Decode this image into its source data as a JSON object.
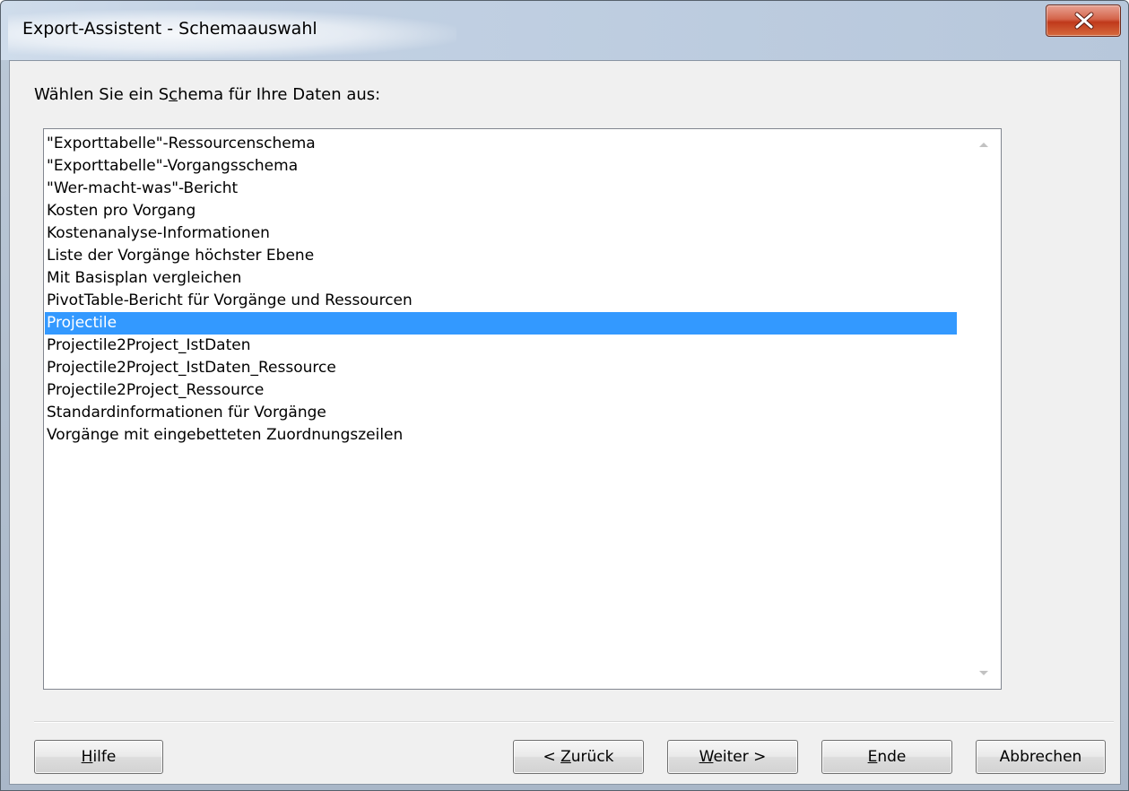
{
  "window": {
    "title": "Export-Assistent - Schemaauswahl"
  },
  "prompt": {
    "before_accel": "Wählen Sie ein S",
    "accel": "c",
    "after_accel": "hema für Ihre Daten aus:"
  },
  "schema_list": {
    "selected_index": 8,
    "items": [
      "\"Exporttabelle\"-Ressourcenschema",
      "\"Exporttabelle\"-Vorgangsschema",
      "\"Wer-macht-was\"-Bericht",
      "Kosten pro Vorgang",
      "Kostenanalyse-Informationen",
      "Liste der Vorgänge höchster Ebene",
      "Mit Basisplan vergleichen",
      "PivotTable-Bericht für Vorgänge und Ressourcen",
      "Projectile",
      "Projectile2Project_IstDaten",
      "Projectile2Project_IstDaten_Ressource",
      "Projectile2Project_Ressource",
      "Standardinformationen für Vorgänge",
      "Vorgänge mit eingebetteten Zuordnungszeilen"
    ]
  },
  "buttons": {
    "help": {
      "accel": "H",
      "rest": "ilfe"
    },
    "back": {
      "prefix": "< ",
      "accel": "Z",
      "rest": "urück"
    },
    "next": {
      "accel": "W",
      "rest": "eiter >"
    },
    "finish": {
      "accel": "E",
      "rest": "nde"
    },
    "cancel": {
      "label": "Abbrechen"
    }
  },
  "colors": {
    "selection": "#3399ff",
    "close_button": "#c7402a"
  }
}
